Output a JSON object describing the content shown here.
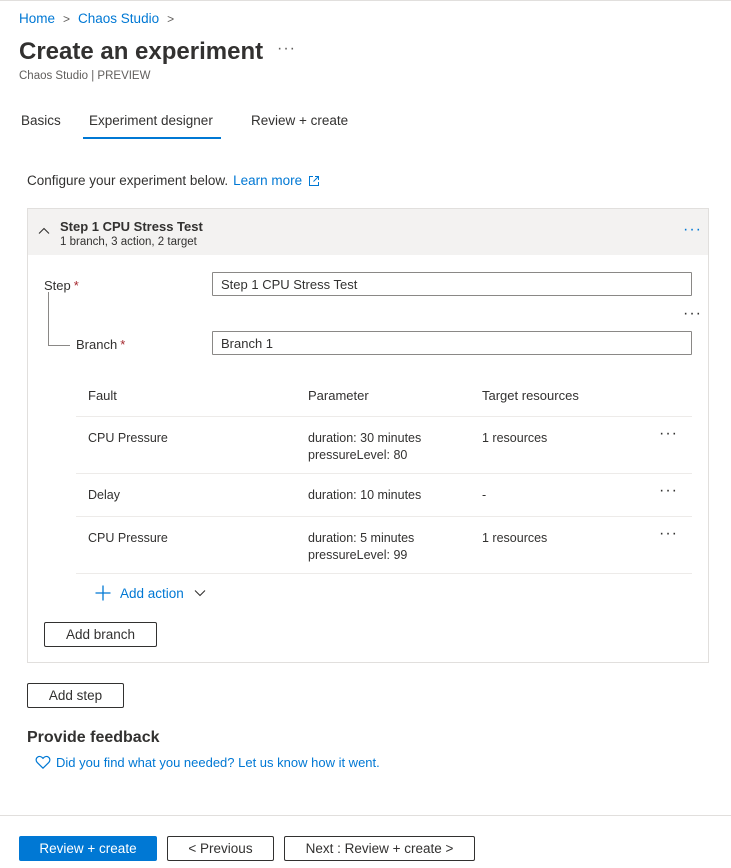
{
  "breadcrumb": {
    "home": "Home",
    "service": "Chaos Studio",
    "separator": ">"
  },
  "page": {
    "title": "Create an experiment",
    "subtitle": "Chaos Studio | PREVIEW",
    "more": "···"
  },
  "tabs": [
    {
      "label": "Basics",
      "active": false
    },
    {
      "label": "Experiment designer",
      "active": true
    },
    {
      "label": "Review + create",
      "active": false
    }
  ],
  "intro": {
    "text": "Configure your experiment below.",
    "link": "Learn more"
  },
  "step": {
    "title": "Step 1 CPU Stress Test",
    "summary": "1 branch, 3 action, 2 target",
    "more": "···",
    "step_label": "Step",
    "step_value": "Step 1 CPU Stress Test",
    "branch_label": "Branch",
    "branch_value": "Branch 1",
    "required_mark": "*",
    "branch_more": "···"
  },
  "table": {
    "headers": {
      "fault": "Fault",
      "parameter": "Parameter",
      "target": "Target resources"
    },
    "rows": [
      {
        "fault": "CPU Pressure",
        "param1": "duration: 30 minutes",
        "param2": "pressureLevel: 80",
        "target": "1 resources",
        "more": "···"
      },
      {
        "fault": "Delay",
        "param1": "duration: 10 minutes",
        "param2": "",
        "target": "-",
        "more": "···"
      },
      {
        "fault": "CPU Pressure",
        "param1": "duration: 5 minutes",
        "param2": "pressureLevel: 99",
        "target": "1 resources",
        "more": "···"
      }
    ]
  },
  "actions": {
    "add_action": "Add action",
    "add_branch": "Add branch",
    "add_step": "Add step"
  },
  "feedback": {
    "title": "Provide feedback",
    "link": "Did you find what you needed? Let us know how it went."
  },
  "footer": {
    "review_create": "Review + create",
    "previous": "< Previous",
    "next": "Next : Review + create >"
  },
  "colors": {
    "accent": "#0078d4",
    "required": "#a4262c",
    "header_bg": "#f3f2f1"
  }
}
